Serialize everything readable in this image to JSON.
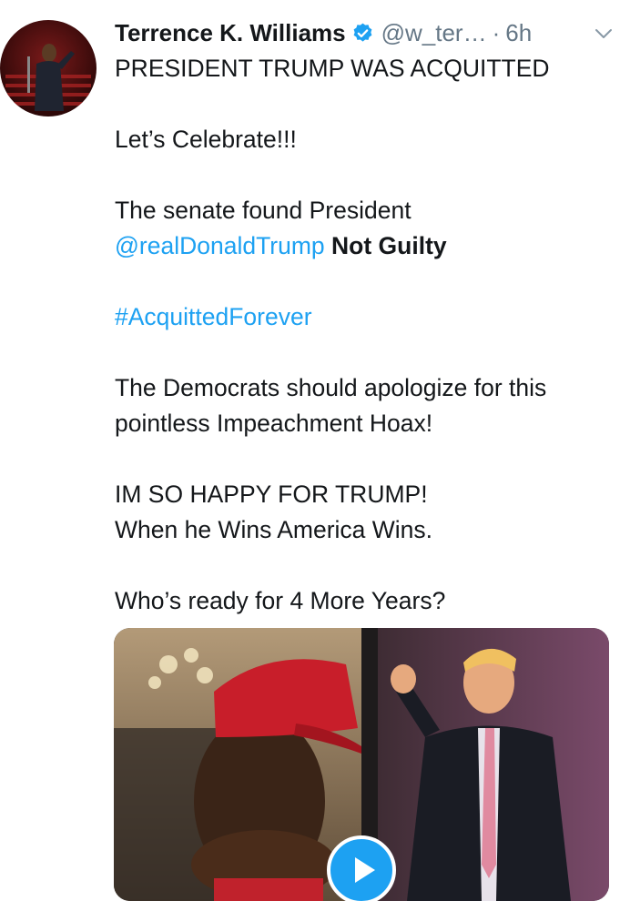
{
  "tweet": {
    "author": {
      "display_name": "Terrence K. Williams",
      "handle": "@w_ter…",
      "separator": "·",
      "time": "6h",
      "verified": true
    },
    "lines": {
      "l1": "PRESIDENT TRUMP WAS ACQUITTED",
      "l2": "Let’s Celebrate!!!",
      "l3": "The senate found President",
      "mention": "@realDonaldTrump",
      "not_guilty": "Not Guilty",
      "hashtag": "#AcquittedForever",
      "l5a": "The Democrats should apologize for this",
      "l5b": "pointless Impeachment Hoax!",
      "l6a": "IM SO HAPPY FOR TRUMP!",
      "l6b": "When he Wins America Wins.",
      "l7": "Who’s ready for 4 More Years?"
    },
    "icons": {
      "verified": "verified-badge-icon",
      "caret": "chevron-down-icon",
      "play": "play-icon"
    },
    "colors": {
      "link": "#1da1f2",
      "text": "#14171a",
      "secondary": "#657786"
    }
  }
}
